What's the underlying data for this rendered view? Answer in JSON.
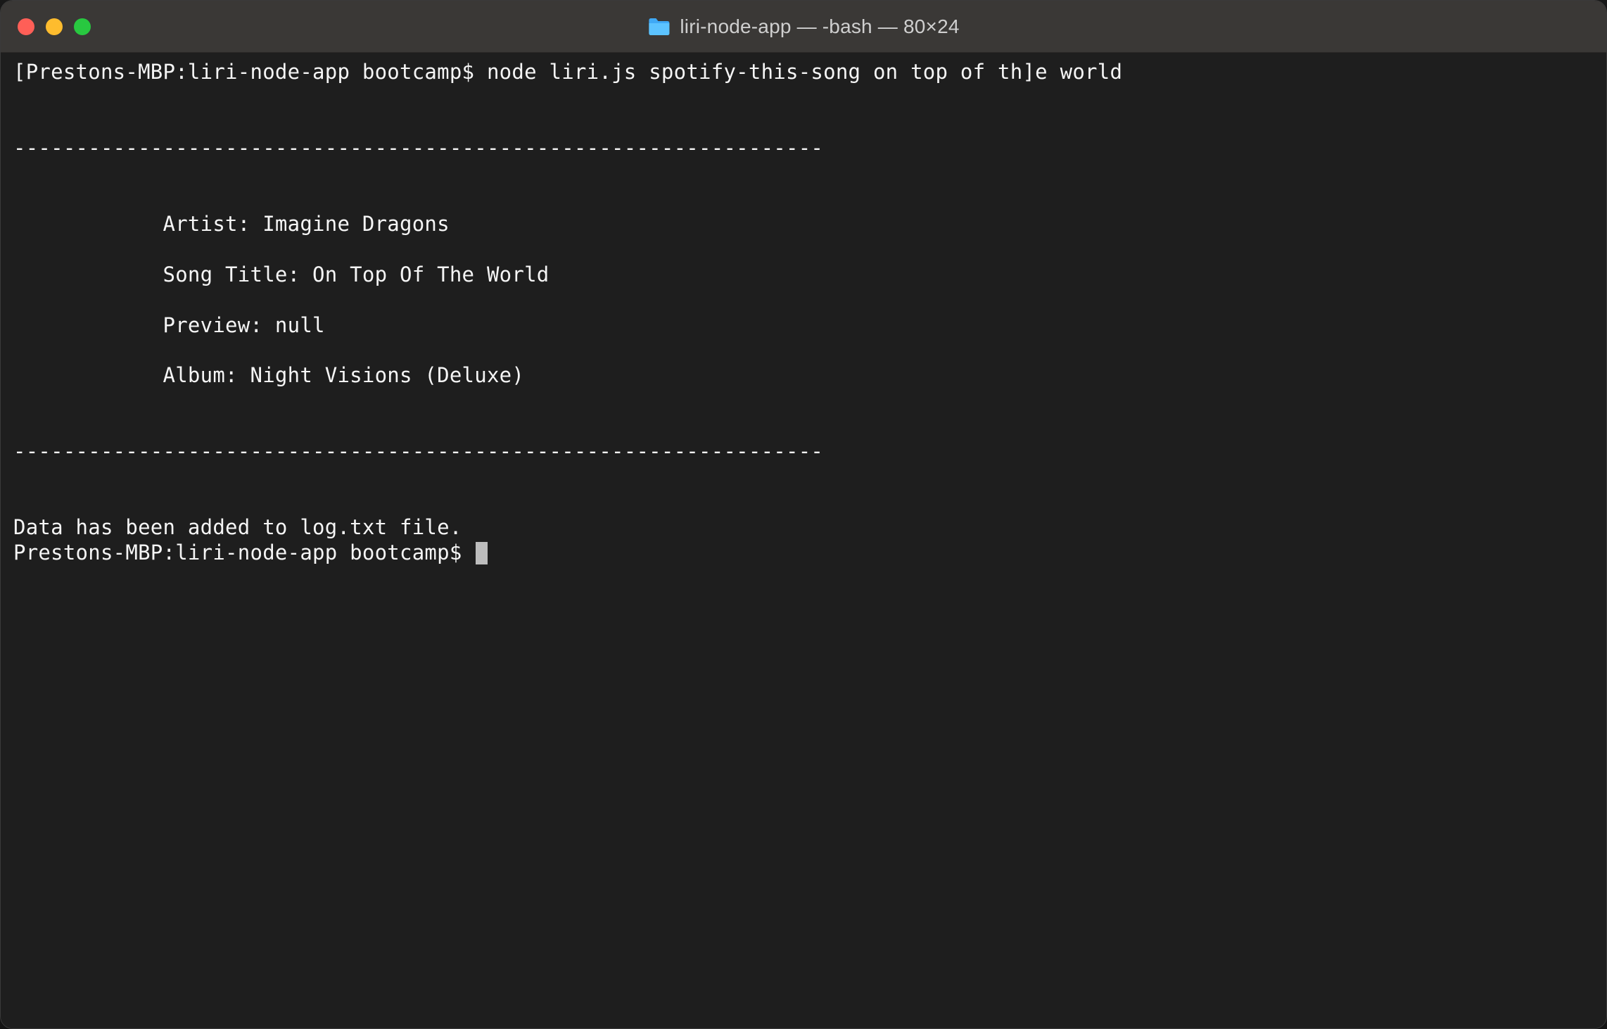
{
  "window": {
    "title": "liri-node-app — -bash — 80×24"
  },
  "terminal": {
    "prompt1_prefix": "[Prestons-MBP:liri-node-app bootcamp$ ",
    "command": "node liri.js spotify-this-song on top of th]e world",
    "blank1": "",
    "blank2": "",
    "divider_top": "-----------------------------------------------------------------",
    "blank3": "",
    "blank4": "",
    "artist_line": "            Artist: Imagine Dragons",
    "blank5": "",
    "songtitle_line": "            Song Title: On Top Of The World",
    "blank6": "",
    "preview_line": "            Preview: null",
    "blank7": "",
    "album_line": "            Album: Night Visions (Deluxe)",
    "blank8": "",
    "blank9": "",
    "divider_bottom": "-----------------------------------------------------------------",
    "blank10": "",
    "blank11": "",
    "log_line": "Data has been added to log.txt file.",
    "prompt2": "Prestons-MBP:liri-node-app bootcamp$ "
  }
}
